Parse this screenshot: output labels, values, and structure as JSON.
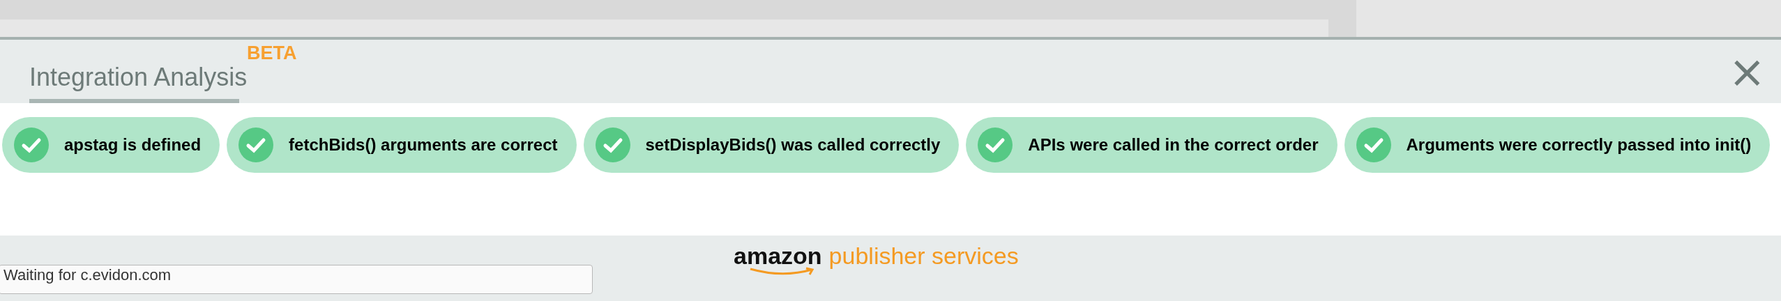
{
  "panel": {
    "title": "Integration Analysis",
    "badge": "BETA",
    "close": "×"
  },
  "checks": [
    {
      "label": "apstag is defined",
      "passed": true
    },
    {
      "label": "fetchBids() arguments are correct",
      "passed": true
    },
    {
      "label": "setDisplayBids() was called correctly",
      "passed": true
    },
    {
      "label": "APIs were called in the correct order",
      "passed": true
    },
    {
      "label": "Arguments were correctly passed into init()",
      "passed": true
    }
  ],
  "footer": {
    "logo_word": "amazon",
    "logo_tail": "publisher services",
    "status": "Waiting for c.evidon.com"
  }
}
